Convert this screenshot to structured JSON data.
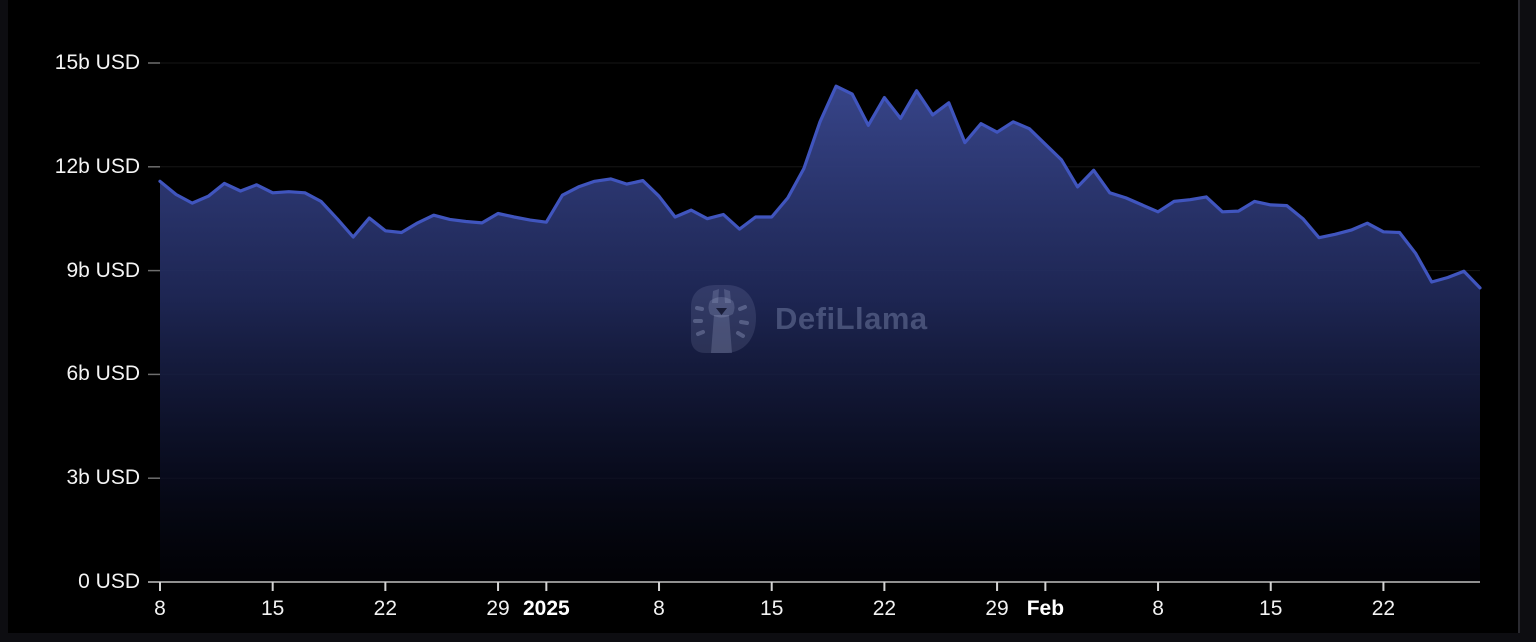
{
  "watermark": {
    "brand": "DefiLlama",
    "logo_icon": "llama-in-rounded-d"
  },
  "colors": {
    "page_background": "#0d0d11",
    "card_background": "#000000",
    "line": "#4055be",
    "area_gradient_top": "#3a488f",
    "area_gradient_bottom": "#03040c",
    "gridline": "rgba(255,255,255,0.085)",
    "axis_line": "#909090",
    "tick": "#d4d4d4",
    "label_text": "#f4f4f4",
    "watermark_text": "rgba(176,188,224,0.30)"
  },
  "chart_data": {
    "type": "area",
    "title": "",
    "xlabel": "",
    "ylabel": "",
    "unit": "b USD",
    "ylim": [
      0,
      15
    ],
    "grid": "horizontal-faint",
    "legend_position": "none",
    "y_ticks": [
      {
        "label": "0 USD",
        "value": 0
      },
      {
        "label": "3b USD",
        "value": 3
      },
      {
        "label": "6b USD",
        "value": 6
      },
      {
        "label": "9b USD",
        "value": 9
      },
      {
        "label": "12b USD",
        "value": 12
      },
      {
        "label": "15b USD",
        "value": 15
      }
    ],
    "x_ticks": [
      {
        "label": "8",
        "day": 0,
        "bold": false
      },
      {
        "label": "15",
        "day": 7,
        "bold": false
      },
      {
        "label": "22",
        "day": 14,
        "bold": false
      },
      {
        "label": "29",
        "day": 21,
        "bold": false
      },
      {
        "label": "2025",
        "day": 24,
        "bold": true
      },
      {
        "label": "8",
        "day": 31,
        "bold": false
      },
      {
        "label": "15",
        "day": 38,
        "bold": false
      },
      {
        "label": "22",
        "day": 45,
        "bold": false
      },
      {
        "label": "29",
        "day": 52,
        "bold": false
      },
      {
        "label": "Feb",
        "day": 55,
        "bold": true
      },
      {
        "label": "8",
        "day": 62,
        "bold": false
      },
      {
        "label": "15",
        "day": 69,
        "bold": false
      },
      {
        "label": "22",
        "day": 76,
        "bold": false
      }
    ],
    "x": [
      "2024-12-08",
      "2024-12-09",
      "2024-12-10",
      "2024-12-11",
      "2024-12-12",
      "2024-12-13",
      "2024-12-14",
      "2024-12-15",
      "2024-12-16",
      "2024-12-17",
      "2024-12-18",
      "2024-12-19",
      "2024-12-20",
      "2024-12-21",
      "2024-12-22",
      "2024-12-23",
      "2024-12-24",
      "2024-12-25",
      "2024-12-26",
      "2024-12-27",
      "2024-12-28",
      "2024-12-29",
      "2024-12-30",
      "2024-12-31",
      "2025-01-01",
      "2025-01-02",
      "2025-01-03",
      "2025-01-04",
      "2025-01-05",
      "2025-01-06",
      "2025-01-07",
      "2025-01-08",
      "2025-01-09",
      "2025-01-10",
      "2025-01-11",
      "2025-01-12",
      "2025-01-13",
      "2025-01-14",
      "2025-01-15",
      "2025-01-16",
      "2025-01-17",
      "2025-01-18",
      "2025-01-19",
      "2025-01-20",
      "2025-01-21",
      "2025-01-22",
      "2025-01-23",
      "2025-01-24",
      "2025-01-25",
      "2025-01-26",
      "2025-01-27",
      "2025-01-28",
      "2025-01-29",
      "2025-01-30",
      "2025-01-31",
      "2025-02-01",
      "2025-02-02",
      "2025-02-03",
      "2025-02-04",
      "2025-02-05",
      "2025-02-06",
      "2025-02-07",
      "2025-02-08",
      "2025-02-09",
      "2025-02-10",
      "2025-02-11",
      "2025-02-12",
      "2025-02-13",
      "2025-02-14",
      "2025-02-15",
      "2025-02-16",
      "2025-02-17",
      "2025-02-18",
      "2025-02-19",
      "2025-02-20",
      "2025-02-21",
      "2025-02-22",
      "2025-02-23",
      "2025-02-24",
      "2025-02-25",
      "2025-02-26",
      "2025-02-27",
      "2025-02-28"
    ],
    "values": [
      11.58,
      11.2,
      10.95,
      11.15,
      11.52,
      11.3,
      11.48,
      11.25,
      11.28,
      11.25,
      11.0,
      10.5,
      9.97,
      10.52,
      10.15,
      10.1,
      10.38,
      10.6,
      10.48,
      10.42,
      10.38,
      10.65,
      10.55,
      10.46,
      10.4,
      11.18,
      11.42,
      11.58,
      11.65,
      11.5,
      11.6,
      11.15,
      10.55,
      10.75,
      10.5,
      10.62,
      10.2,
      10.55,
      10.55,
      11.1,
      11.95,
      13.3,
      14.33,
      14.1,
      13.2,
      14.0,
      13.4,
      14.2,
      13.5,
      13.85,
      12.7,
      13.25,
      13.0,
      13.3,
      13.1,
      12.65,
      12.2,
      11.42,
      11.9,
      11.25,
      11.1,
      10.9,
      10.7,
      11.0,
      11.05,
      11.13,
      10.7,
      10.72,
      11.0,
      10.9,
      10.88,
      10.5,
      9.95,
      10.05,
      10.17,
      10.37,
      10.12,
      10.1,
      9.5,
      8.67,
      8.8,
      8.98,
      8.5
    ]
  }
}
